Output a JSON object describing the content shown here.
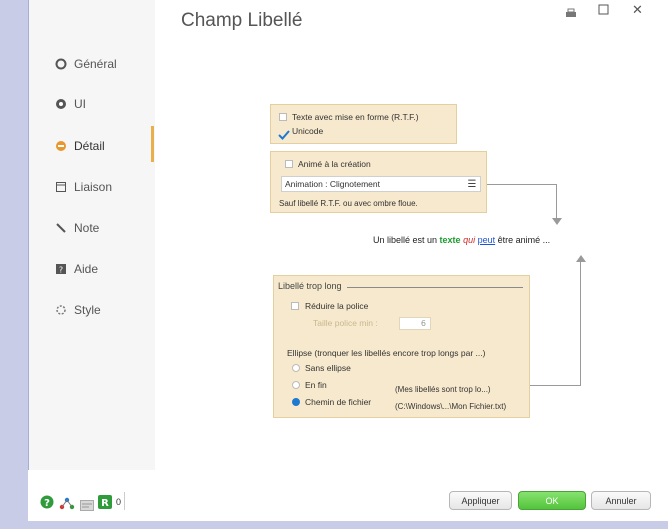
{
  "window": {
    "title": "Champ Libellé"
  },
  "sidebar": {
    "items": [
      {
        "label": "Général",
        "icon": "circle-icon"
      },
      {
        "label": "UI",
        "icon": "ui-icon"
      },
      {
        "label": "Détail",
        "icon": "detail-icon"
      },
      {
        "label": "Liaison",
        "icon": "link-icon"
      },
      {
        "label": "Note",
        "icon": "pencil-icon"
      },
      {
        "label": "Aide",
        "icon": "help-book-icon"
      },
      {
        "label": "Style",
        "icon": "style-icon"
      }
    ],
    "active": "Détail"
  },
  "panel_rtf": {
    "rtf_label": "Texte avec mise en forme (R.T.F.)",
    "rtf_checked": false,
    "unicode_label": "Unicode",
    "unicode_checked": true
  },
  "panel_anim": {
    "animate_label": "Animé à la création",
    "animate_checked": false,
    "combo_value": "Animation : Clignotement",
    "note": "Sauf libellé R.T.F. ou avec ombre floue."
  },
  "sample": {
    "p1": "Un libellé est un ",
    "w_texte": "texte",
    "w_qui": "qui",
    "w_peut": "peut",
    "p2": " être animé ..."
  },
  "panel_long": {
    "section_title": "Libellé trop long",
    "reduce_label": "Réduire la police",
    "reduce_checked": false,
    "min_size_label": "Taille police min :",
    "min_size_value": "6",
    "ellipse_label": "Ellipse (tronquer les libellés encore trop longs par ...)",
    "options": [
      {
        "label": "Sans ellipse",
        "selected": false
      },
      {
        "label": "En fin",
        "selected": false
      },
      {
        "label": "Chemin de fichier",
        "selected": true
      }
    ],
    "hint_end": "(Mes libellés sont trop lo...)",
    "hint_path": "(C:\\Windows\\...\\Mon Fichier.txt)"
  },
  "footer": {
    "counter": "0",
    "apply_label": "Appliquer",
    "ok_label": "OK",
    "cancel_label": "Annuler"
  },
  "colors": {
    "panel_bg": "#f7e9cd",
    "accent_orange": "#e8b04a",
    "ok_green": "#53c43b"
  }
}
